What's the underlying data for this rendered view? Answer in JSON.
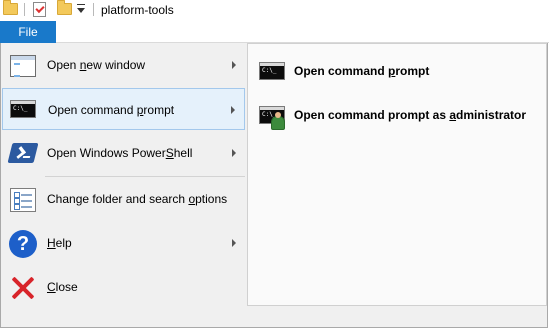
{
  "window": {
    "title": "platform-tools"
  },
  "ribbon": {
    "file_tab": "File"
  },
  "menu": {
    "items": [
      {
        "pre": "Open ",
        "key": "n",
        "post": "ew window",
        "icon": "new-window-icon",
        "has_submenu": true,
        "highlighted": false
      },
      {
        "pre": "Open command ",
        "key": "p",
        "post": "rompt",
        "icon": "command-prompt-icon",
        "has_submenu": true,
        "highlighted": true
      },
      {
        "pre": "Open Windows Power",
        "key": "S",
        "post": "hell",
        "icon": "powershell-icon",
        "has_submenu": true,
        "highlighted": false
      },
      {
        "pre": "Change folder and search ",
        "key": "o",
        "post": "ptions",
        "icon": "folder-options-icon",
        "has_submenu": false,
        "highlighted": false
      },
      {
        "pre": "",
        "key": "H",
        "post": "elp",
        "icon": "help-icon",
        "has_submenu": true,
        "highlighted": false
      },
      {
        "pre": "",
        "key": "C",
        "post": "lose",
        "icon": "close-icon",
        "has_submenu": false,
        "highlighted": false
      }
    ]
  },
  "submenu": {
    "items": [
      {
        "pre": "Open command ",
        "key": "p",
        "post": "rompt",
        "icon": "command-prompt-icon"
      },
      {
        "pre": "Open command prompt as ",
        "key": "a",
        "post": "dministrator",
        "icon": "command-prompt-admin-icon"
      }
    ]
  },
  "colors": {
    "file_tab": "#1979ca",
    "highlight_bg": "#e5f1fb",
    "highlight_border": "#a3c8ec",
    "menu_bg": "#f0f0f0"
  }
}
